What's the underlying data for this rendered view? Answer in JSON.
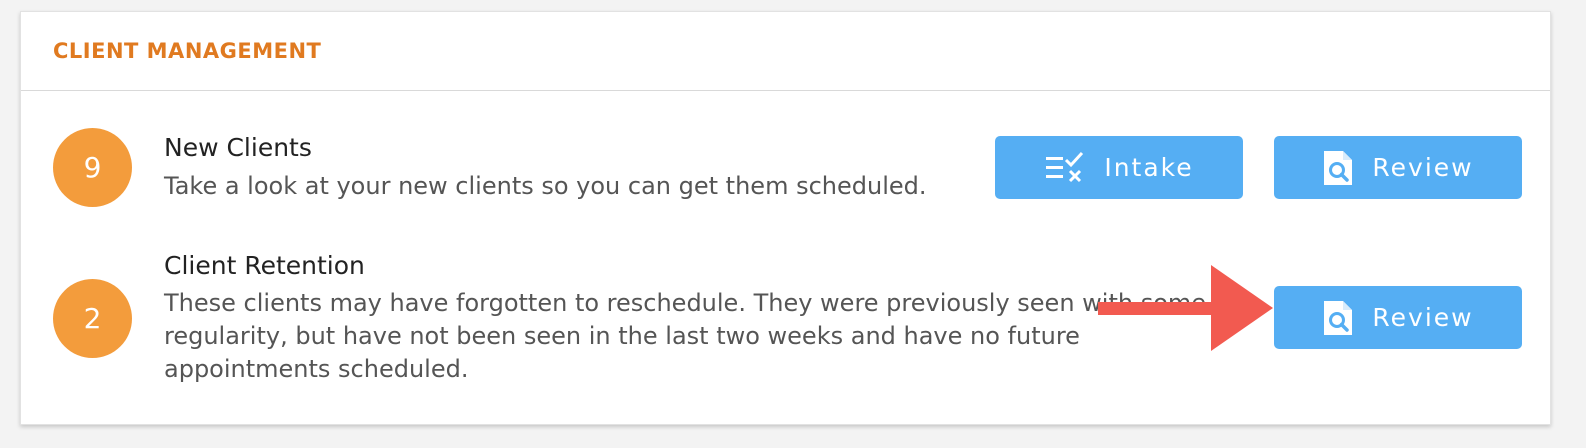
{
  "section": {
    "title": "CLIENT MANAGEMENT"
  },
  "items": [
    {
      "count": "9",
      "title": "New Clients",
      "description": "Take a look at your new clients so you can get them scheduled.",
      "intake_label": "Intake",
      "review_label": "Review"
    },
    {
      "count": "2",
      "title": "Client Retention",
      "description": "These clients may have forgotten to reschedule. They were previously seen with some regularity, but have not been seen in the last two weeks and have no future appointments scheduled.",
      "review_label": "Review"
    }
  ],
  "colors": {
    "accent_orange": "#e07a20",
    "badge": "#f39c3c",
    "button": "#55aef3",
    "annotation_arrow": "#f25a50"
  },
  "icons": {
    "intake": "checklist-icon",
    "review": "document-search-icon",
    "annotation": "red-arrow-icon"
  }
}
